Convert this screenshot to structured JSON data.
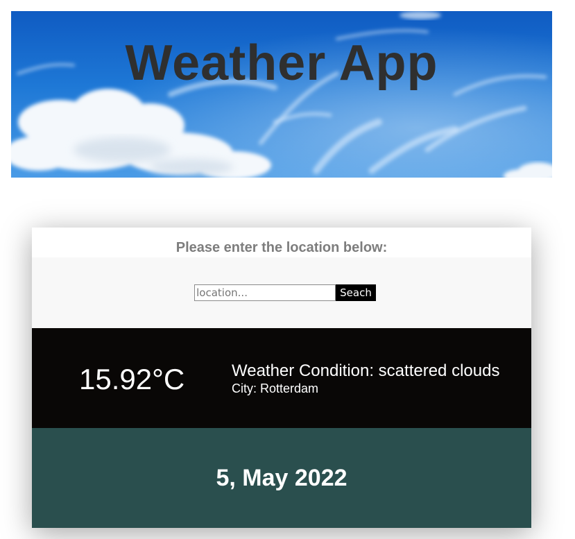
{
  "header": {
    "title": "Weather App"
  },
  "search": {
    "prompt": "Please enter the location below:",
    "placeholder": "location...",
    "button_label": "Seach"
  },
  "current": {
    "temperature": "15.92°C",
    "condition": "Weather Condition: scattered clouds",
    "city": "City: Rotterdam"
  },
  "date": {
    "text": "5, May 2022"
  },
  "colors": {
    "current_panel_bg": "#090706",
    "date_panel_bg": "#2a4f4e",
    "title_color": "#2f2f2f",
    "prompt_color": "#7d7d7d"
  },
  "icons": {
    "banner": "sky-with-clouds-image"
  }
}
